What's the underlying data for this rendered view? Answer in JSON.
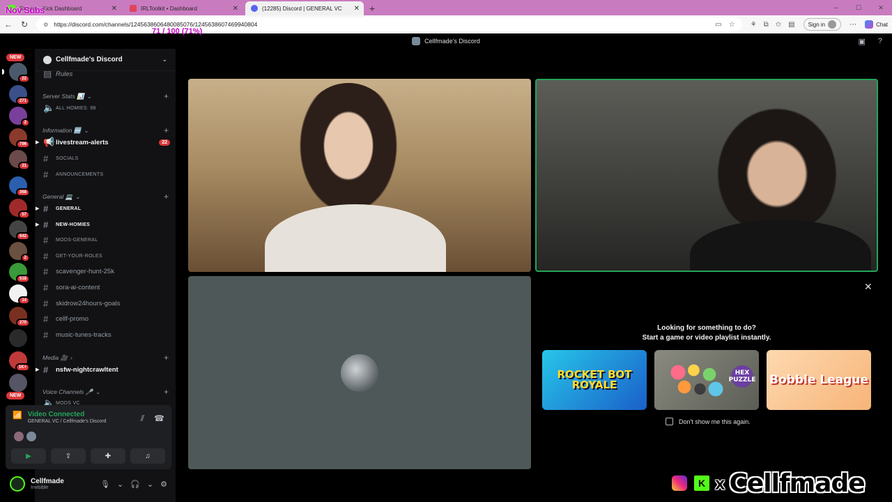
{
  "browser": {
    "tabs": [
      {
        "label": "Stream · Kick Dashboard",
        "icon": "kick-icon"
      },
      {
        "label": "IRLToolkit • Dashboard",
        "icon": "irltoolkit-icon"
      },
      {
        "label": "(12285) Discord | GENERAL VC",
        "icon": "discord-icon"
      }
    ],
    "new_tab": "+",
    "url": "https://discord.com/channels/1245638606480085076/1245638607469940804",
    "sign_in": "Sign in",
    "chat": "Chat"
  },
  "overlay": {
    "subs_label": "Nov Subs",
    "goal_text": "71 / 100 (71%)"
  },
  "window": {
    "title": "Cellfmade's Discord"
  },
  "server_rail": {
    "new_label": "NEW",
    "badges": [
      "22",
      "271",
      "2",
      "796",
      "31",
      "368",
      "57",
      "642",
      "2",
      "518",
      "14",
      "270",
      "",
      "1K+"
    ],
    "bottom_new_label": "NEW"
  },
  "sidebar": {
    "server_name": "Cellfmade's Discord",
    "rules": "Rules",
    "categories": {
      "server_stats": "Server Stats 📊",
      "information": "Information 🆕",
      "general": "General 💻",
      "media": "Media 🎥",
      "voice": "Voice Channels 🎤"
    },
    "channels": {
      "all_homies": "ALL HOMIES: 98",
      "livestream_alerts": "livestream-alerts",
      "livestream_count": "22",
      "socials": "SOCIALS",
      "announcements": "ANNOUNCEMENTS",
      "general": "GENERAL",
      "new_homies": "NEW-HOMIES",
      "mods_general": "MODS-GENERAL",
      "get_your_roles": "GET-YOUR-ROLES",
      "scavenger": "scavenger-hunt-25k",
      "sora": "sora-ai-content",
      "skidrow": "skidrow24hours-goals",
      "cellf_promo": "cellf-promo",
      "music": "music-tunes-tracks",
      "nsfw": "nsfw-nightcrawltent",
      "mods_vc": "MODS VC"
    }
  },
  "voice_panel": {
    "status": "Video Connected",
    "location": "GENERAL VC / Cellfmade's Discord"
  },
  "user": {
    "name": "Cellfmade",
    "status": "Invisible"
  },
  "activity": {
    "line1": "Looking for something to do?",
    "line2": "Start a game or video playlist instantly.",
    "games": [
      "ROCKET BOT ROYALE",
      "HEX PUZZLE",
      "Bobble League"
    ],
    "dont_show": "Don't show me this again."
  },
  "brand": {
    "x": "x",
    "handle": "Cellfmade"
  }
}
